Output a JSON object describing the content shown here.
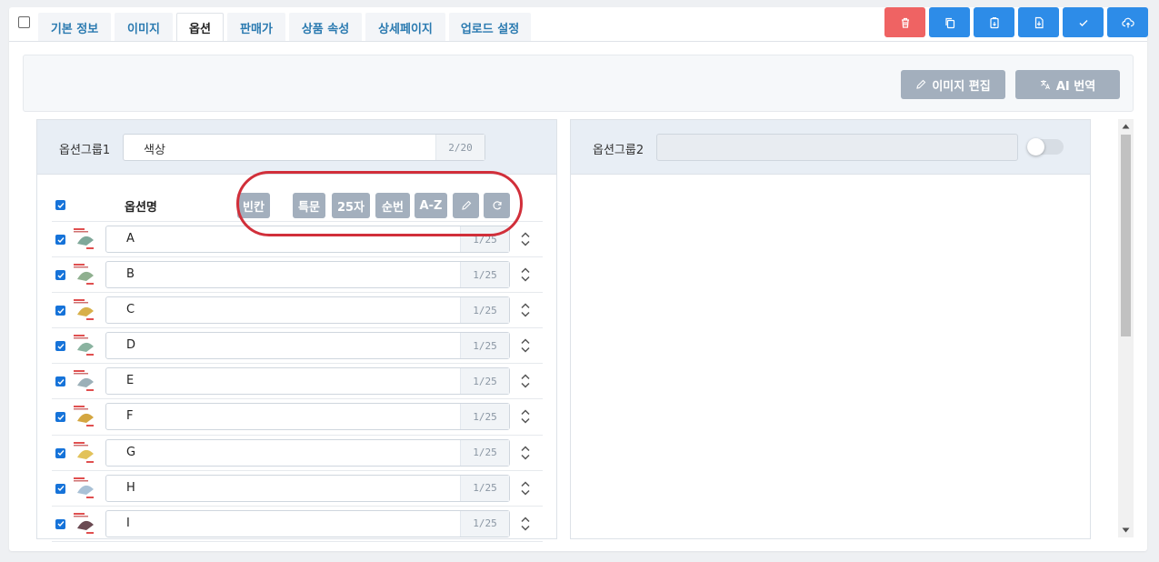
{
  "tabs": [
    {
      "label": "기본 정보",
      "active": false
    },
    {
      "label": "이미지",
      "active": false
    },
    {
      "label": "옵션",
      "active": true
    },
    {
      "label": "판매가",
      "active": false
    },
    {
      "label": "상품 속성",
      "active": false
    },
    {
      "label": "상세페이지",
      "active": false
    },
    {
      "label": "업로드 설정",
      "active": false
    }
  ],
  "actions": [
    {
      "icon": "trash-icon",
      "color": "#ef6363"
    },
    {
      "icon": "copy-icon",
      "color": "#2d8ce8"
    },
    {
      "icon": "clipboard-paste-icon",
      "color": "#2d8ce8"
    },
    {
      "icon": "file-export-icon",
      "color": "#2d8ce8"
    },
    {
      "icon": "check-icon",
      "color": "#2d8ce8"
    },
    {
      "icon": "cloud-upload-icon",
      "color": "#2d8ce8"
    }
  ],
  "toolbar": {
    "edit_image_label": "이미지 편집",
    "ai_translate_label": "AI 번역"
  },
  "group1": {
    "label": "옵션그룹1",
    "value": "색상",
    "count": "2/20",
    "column_title": "옵션명",
    "tools": [
      "빈칸",
      "특문",
      "25자",
      "순번",
      "A-Z"
    ]
  },
  "group2": {
    "label": "옵션그룹2",
    "value": "",
    "toggle_on": false
  },
  "options": [
    {
      "name": "A",
      "count": "1/25",
      "checked": true
    },
    {
      "name": "B",
      "count": "1/25",
      "checked": true
    },
    {
      "name": "C",
      "count": "1/25",
      "checked": true
    },
    {
      "name": "D",
      "count": "1/25",
      "checked": true
    },
    {
      "name": "E",
      "count": "1/25",
      "checked": true
    },
    {
      "name": "F",
      "count": "1/25",
      "checked": true
    },
    {
      "name": "G",
      "count": "1/25",
      "checked": true
    },
    {
      "name": "H",
      "count": "1/25",
      "checked": true
    },
    {
      "name": "I",
      "count": "1/25",
      "checked": true
    }
  ],
  "colors": {
    "accent": "#2d8ce8",
    "danger": "#ef6363",
    "checkbox": "#1673d9",
    "tool_button": "#a3afbd",
    "highlight_ring": "#d12f3a"
  }
}
